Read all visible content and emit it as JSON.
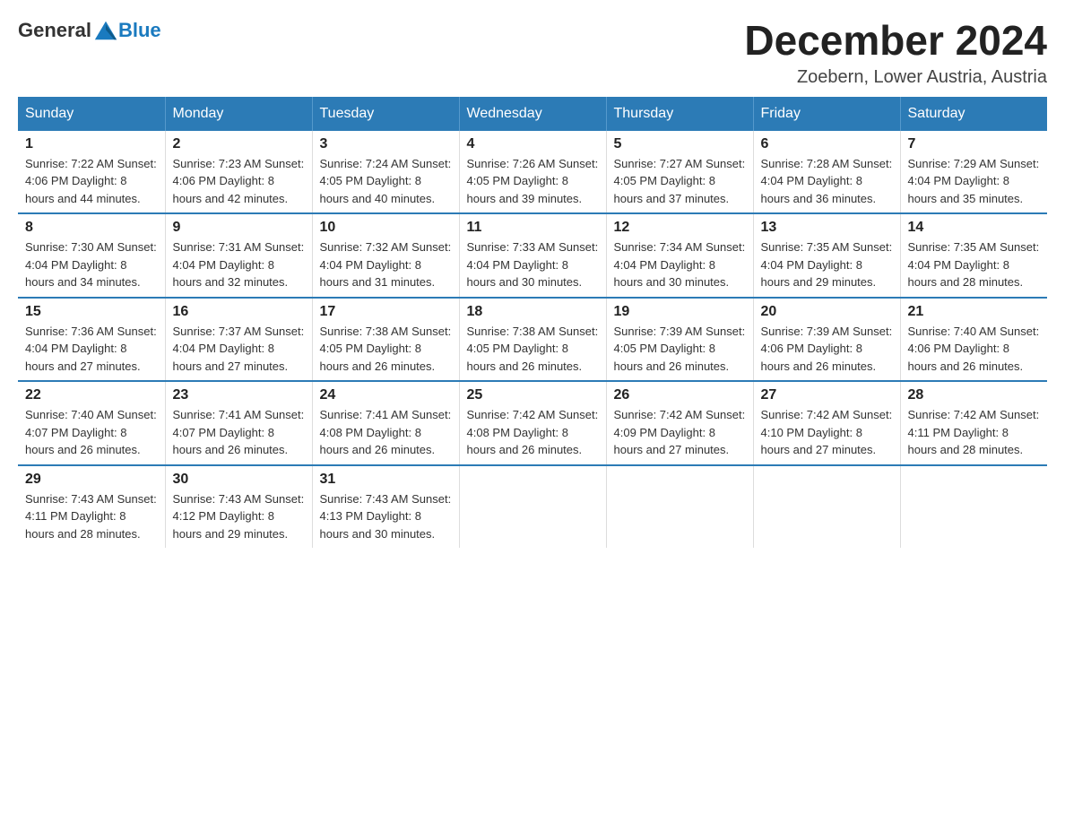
{
  "header": {
    "logo_general": "General",
    "logo_blue": "Blue",
    "month_title": "December 2024",
    "location": "Zoebern, Lower Austria, Austria"
  },
  "weekdays": [
    "Sunday",
    "Monday",
    "Tuesday",
    "Wednesday",
    "Thursday",
    "Friday",
    "Saturday"
  ],
  "weeks": [
    [
      {
        "day": "1",
        "info": "Sunrise: 7:22 AM\nSunset: 4:06 PM\nDaylight: 8 hours\nand 44 minutes."
      },
      {
        "day": "2",
        "info": "Sunrise: 7:23 AM\nSunset: 4:06 PM\nDaylight: 8 hours\nand 42 minutes."
      },
      {
        "day": "3",
        "info": "Sunrise: 7:24 AM\nSunset: 4:05 PM\nDaylight: 8 hours\nand 40 minutes."
      },
      {
        "day": "4",
        "info": "Sunrise: 7:26 AM\nSunset: 4:05 PM\nDaylight: 8 hours\nand 39 minutes."
      },
      {
        "day": "5",
        "info": "Sunrise: 7:27 AM\nSunset: 4:05 PM\nDaylight: 8 hours\nand 37 minutes."
      },
      {
        "day": "6",
        "info": "Sunrise: 7:28 AM\nSunset: 4:04 PM\nDaylight: 8 hours\nand 36 minutes."
      },
      {
        "day": "7",
        "info": "Sunrise: 7:29 AM\nSunset: 4:04 PM\nDaylight: 8 hours\nand 35 minutes."
      }
    ],
    [
      {
        "day": "8",
        "info": "Sunrise: 7:30 AM\nSunset: 4:04 PM\nDaylight: 8 hours\nand 34 minutes."
      },
      {
        "day": "9",
        "info": "Sunrise: 7:31 AM\nSunset: 4:04 PM\nDaylight: 8 hours\nand 32 minutes."
      },
      {
        "day": "10",
        "info": "Sunrise: 7:32 AM\nSunset: 4:04 PM\nDaylight: 8 hours\nand 31 minutes."
      },
      {
        "day": "11",
        "info": "Sunrise: 7:33 AM\nSunset: 4:04 PM\nDaylight: 8 hours\nand 30 minutes."
      },
      {
        "day": "12",
        "info": "Sunrise: 7:34 AM\nSunset: 4:04 PM\nDaylight: 8 hours\nand 30 minutes."
      },
      {
        "day": "13",
        "info": "Sunrise: 7:35 AM\nSunset: 4:04 PM\nDaylight: 8 hours\nand 29 minutes."
      },
      {
        "day": "14",
        "info": "Sunrise: 7:35 AM\nSunset: 4:04 PM\nDaylight: 8 hours\nand 28 minutes."
      }
    ],
    [
      {
        "day": "15",
        "info": "Sunrise: 7:36 AM\nSunset: 4:04 PM\nDaylight: 8 hours\nand 27 minutes."
      },
      {
        "day": "16",
        "info": "Sunrise: 7:37 AM\nSunset: 4:04 PM\nDaylight: 8 hours\nand 27 minutes."
      },
      {
        "day": "17",
        "info": "Sunrise: 7:38 AM\nSunset: 4:05 PM\nDaylight: 8 hours\nand 26 minutes."
      },
      {
        "day": "18",
        "info": "Sunrise: 7:38 AM\nSunset: 4:05 PM\nDaylight: 8 hours\nand 26 minutes."
      },
      {
        "day": "19",
        "info": "Sunrise: 7:39 AM\nSunset: 4:05 PM\nDaylight: 8 hours\nand 26 minutes."
      },
      {
        "day": "20",
        "info": "Sunrise: 7:39 AM\nSunset: 4:06 PM\nDaylight: 8 hours\nand 26 minutes."
      },
      {
        "day": "21",
        "info": "Sunrise: 7:40 AM\nSunset: 4:06 PM\nDaylight: 8 hours\nand 26 minutes."
      }
    ],
    [
      {
        "day": "22",
        "info": "Sunrise: 7:40 AM\nSunset: 4:07 PM\nDaylight: 8 hours\nand 26 minutes."
      },
      {
        "day": "23",
        "info": "Sunrise: 7:41 AM\nSunset: 4:07 PM\nDaylight: 8 hours\nand 26 minutes."
      },
      {
        "day": "24",
        "info": "Sunrise: 7:41 AM\nSunset: 4:08 PM\nDaylight: 8 hours\nand 26 minutes."
      },
      {
        "day": "25",
        "info": "Sunrise: 7:42 AM\nSunset: 4:08 PM\nDaylight: 8 hours\nand 26 minutes."
      },
      {
        "day": "26",
        "info": "Sunrise: 7:42 AM\nSunset: 4:09 PM\nDaylight: 8 hours\nand 27 minutes."
      },
      {
        "day": "27",
        "info": "Sunrise: 7:42 AM\nSunset: 4:10 PM\nDaylight: 8 hours\nand 27 minutes."
      },
      {
        "day": "28",
        "info": "Sunrise: 7:42 AM\nSunset: 4:11 PM\nDaylight: 8 hours\nand 28 minutes."
      }
    ],
    [
      {
        "day": "29",
        "info": "Sunrise: 7:43 AM\nSunset: 4:11 PM\nDaylight: 8 hours\nand 28 minutes."
      },
      {
        "day": "30",
        "info": "Sunrise: 7:43 AM\nSunset: 4:12 PM\nDaylight: 8 hours\nand 29 minutes."
      },
      {
        "day": "31",
        "info": "Sunrise: 7:43 AM\nSunset: 4:13 PM\nDaylight: 8 hours\nand 30 minutes."
      },
      {
        "day": "",
        "info": ""
      },
      {
        "day": "",
        "info": ""
      },
      {
        "day": "",
        "info": ""
      },
      {
        "day": "",
        "info": ""
      }
    ]
  ]
}
